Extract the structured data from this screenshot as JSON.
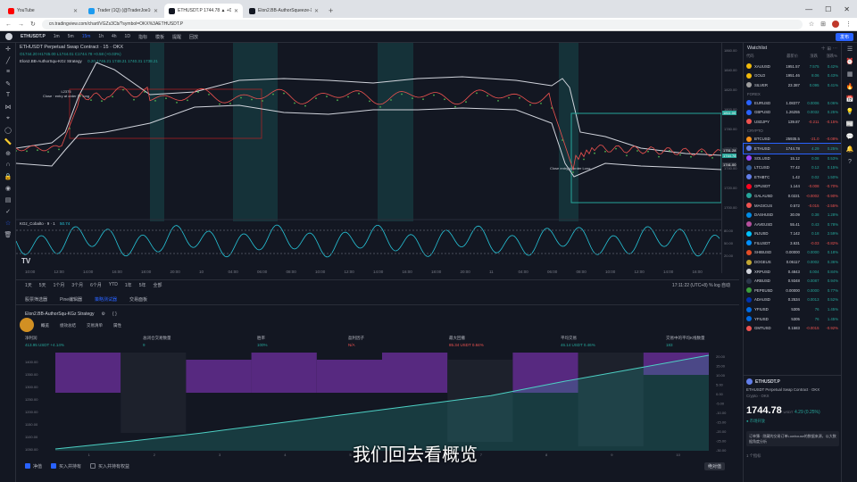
{
  "browser": {
    "tabs": [
      {
        "label": "YouTube",
        "color": "#ff0000",
        "active": false
      },
      {
        "label": "Trader (1Q) (@TraderJoe1Q) / X",
        "color": "#1d9bf0",
        "active": false
      },
      {
        "label": "ETHUSDT.P 1744.78 ▲ +0.25%",
        "color": "#131722",
        "active": true
      },
      {
        "label": "Elon2.BB-AuthorSqueeze-XG",
        "color": "#131722",
        "active": false
      }
    ],
    "url": "cn.tradingview.com/chart/VGZs3Cb/?symbol=OKX%3AETHUSDT.P"
  },
  "toolbar": {
    "symbol": "ETHUSDT.P",
    "buttons": [
      "1m",
      "5m",
      "15m",
      "1h",
      "4h",
      "1D",
      "指标",
      "模板",
      "提醒",
      "回放"
    ],
    "active_interval": "15m",
    "publish_label": "发布"
  },
  "chart": {
    "title": "ETHUSDT Perpetual Swap Contract · 15 · OKX",
    "ohlc": "O1744.20 H1745.00 L1744.01 C1744.78 +0.58 (+0.03%)",
    "indicator": "Elon2.BB-AuthorSqu-KGz Strategy",
    "indicator_vals": "0.20 1746.21 1748.21 1740.31 1738.21",
    "oscillator_label": "KGz_Cobalto · 9 · 1",
    "oscillator_val": "50.74",
    "price_labels": [
      "1860.00",
      "1840.00",
      "1820.00",
      "1800.00",
      "1780.00",
      "1760.00",
      "1740.00",
      "1720.00",
      "1700.00"
    ],
    "price_tags": [
      {
        "text": "1811.00",
        "color": "#26a69a"
      },
      {
        "text": "1751.28",
        "color": "#2a2e39"
      },
      {
        "text": "1744.78",
        "color": "#26a69a"
      },
      {
        "text": "1741.00",
        "color": "#2a2e39"
      }
    ],
    "osc_labels": [
      "80.00",
      "50.00",
      "20.00"
    ],
    "x_labels": [
      "10:00",
      "12:00",
      "14:00",
      "16:00",
      "18:00",
      "20:00",
      "10",
      "04:00",
      "06:00",
      "08:00",
      "10:00",
      "12:00",
      "14:00",
      "16:00",
      "18:00",
      "20:00",
      "11",
      "04:00",
      "06:00",
      "08:00",
      "10:00",
      "12:00",
      "14:00",
      "16:00"
    ],
    "annotations": [
      {
        "text": "L2375\nClose · entry at order 1 · long"
      },
      {
        "text": "Close entry(s) order Long"
      }
    ],
    "tv_logo": "TV"
  },
  "range_bar": {
    "items": [
      "1天",
      "5天",
      "1个月",
      "3个月",
      "6个月",
      "YTD",
      "1年",
      "5年",
      "全部"
    ],
    "right": "17:11:22 (UTC+8)  %  log  自动"
  },
  "panel_tabs": {
    "items": [
      "股票筛选器",
      "Pine编辑器",
      "策略测试器",
      "交易面板"
    ],
    "active": 2
  },
  "strategy": {
    "name": "Elon2.BB-AuthorSqu-KGz Strategy",
    "subtabs": [
      "概览",
      "绩效总结",
      "交易清单",
      "属性"
    ]
  },
  "metrics": [
    {
      "label": "净利润",
      "value": "413.95 USDT  +4.14%",
      "color": "up"
    },
    {
      "label": "总闭仓交易数量",
      "value": "9",
      "color": "up"
    },
    {
      "label": "胜率",
      "value": "100%",
      "color": "up"
    },
    {
      "label": "盈利因子",
      "value": "N/A",
      "color": "red"
    },
    {
      "label": "最大回撤",
      "value": "85.34 USDT  0.84%",
      "color": "red"
    },
    {
      "label": "平均交易",
      "value": "46.14 USDT  0.46%",
      "color": "up"
    },
    {
      "label": "交易中的平均K线数量",
      "value": "183",
      "color": "up"
    }
  ],
  "equity_chart": {
    "type": "area",
    "y_left": [
      "1400.00",
      "1350.00",
      "1300.00",
      "1250.00",
      "1200.00",
      "1150.00",
      "1100.00",
      "1050.00"
    ],
    "y_right": [
      "20.00",
      "15.00",
      "10.00",
      "5.00",
      "0.00",
      "-5.00",
      "-10.00",
      "-15.00",
      "-20.00",
      "-25.00",
      "-30.00"
    ],
    "x_ticks": [
      "1",
      "2",
      "3",
      "4",
      "5",
      "6",
      "7",
      "8",
      "9",
      "10"
    ],
    "bars": [
      {
        "kind": "purple",
        "top": 0,
        "bottom": 45
      },
      {
        "kind": "dark",
        "top": 0,
        "bottom": 90
      },
      {
        "kind": "purple",
        "top": 8,
        "bottom": 45
      },
      {
        "kind": "purple",
        "top": 0,
        "bottom": 45
      },
      {
        "kind": "purple",
        "top": 8,
        "bottom": 45
      },
      {
        "kind": "purple",
        "top": 0,
        "bottom": 45
      },
      {
        "kind": "dark",
        "top": 8,
        "bottom": 100
      },
      {
        "kind": "purple",
        "top": 0,
        "bottom": 45
      },
      {
        "kind": "dark",
        "top": 0,
        "bottom": 105
      },
      {
        "kind": "purple",
        "top": 0,
        "bottom": 25
      }
    ],
    "equity": [
      0,
      0.08,
      0.17,
      0.27,
      0.37,
      0.47,
      0.57,
      0.72,
      0.86,
      1.0
    ]
  },
  "bottom_legend": {
    "items": [
      "净值",
      "买入并持有"
    ],
    "extra": "买入并持有权益",
    "abs_label": "绝对值"
  },
  "watchlist": {
    "title": "Watchlist",
    "cols": [
      "代码",
      "最新价",
      "涨跌",
      "涨跌%"
    ],
    "sections": [
      {
        "name": "",
        "rows": [
          {
            "s": "XAUUSD",
            "p": "1951.57",
            "c": "7.575",
            "cp": "0.42%",
            "up": true,
            "color": "#f0b90b"
          },
          {
            "s": "GOLD",
            "p": "1951.46",
            "c": "8.06",
            "cp": "0.43%",
            "up": true,
            "color": "#f0b90b"
          },
          {
            "s": "SILVER",
            "p": "23.387",
            "c": "0.095",
            "cp": "0.41%",
            "up": true,
            "color": "#9e9e9e"
          }
        ]
      },
      {
        "name": "FOREX",
        "rows": [
          {
            "s": "EURUSD",
            "p": "1.08377",
            "c": "0.0006",
            "cp": "0.06%",
            "up": true,
            "color": "#2962ff"
          },
          {
            "s": "GBPUSD",
            "p": "1.26255",
            "c": "0.0032",
            "cp": "0.25%",
            "up": true,
            "color": "#2962ff"
          },
          {
            "s": "USDJPY",
            "p": "139.87",
            "c": "-0.211",
            "cp": "-0.15%",
            "up": false,
            "color": "#ef5350"
          }
        ]
      },
      {
        "name": "CRYPTO",
        "rows": [
          {
            "s": "BTCUSD",
            "p": "25935.5",
            "c": "-21.0",
            "cp": "-0.08%",
            "up": false,
            "color": "#f7931a"
          },
          {
            "s": "ETHUSD",
            "p": "1744.78",
            "c": "4.29",
            "cp": "0.25%",
            "up": true,
            "color": "#627eea",
            "sel": true
          },
          {
            "s": "SOLUSD",
            "p": "15.12",
            "c": "0.08",
            "cp": "0.53%",
            "up": true,
            "color": "#9945ff"
          },
          {
            "s": "LTCUSD",
            "p": "77.42",
            "c": "0.12",
            "cp": "0.15%",
            "up": true,
            "color": "#345d9d"
          },
          {
            "s": "ETHBTC",
            "p": "1.42",
            "c": "0.02",
            "cp": "1.50%",
            "up": true,
            "color": "#627eea"
          },
          {
            "s": "OPUSDT",
            "p": "1.144",
            "c": "-0.008",
            "cp": "-0.70%",
            "up": false,
            "color": "#ff0420"
          },
          {
            "s": "GALAUSD",
            "p": "0.0221",
            "c": "-0.0002",
            "cp": "-0.90%",
            "up": false,
            "color": "#26a69a"
          },
          {
            "s": "MAGICUS",
            "p": "0.572",
            "c": "-0.015",
            "cp": "-2.55%",
            "up": false,
            "color": "#ef5350"
          },
          {
            "s": "DASHUSD",
            "p": "30.09",
            "c": "0.38",
            "cp": "1.28%",
            "up": true,
            "color": "#008ce7"
          },
          {
            "s": "AAVEUSD",
            "p": "55.41",
            "c": "0.43",
            "cp": "0.78%",
            "up": true,
            "color": "#b6509e"
          },
          {
            "s": "INJUSD",
            "p": "7.142",
            "c": "0.18",
            "cp": "2.59%",
            "up": true,
            "color": "#00c2ff"
          },
          {
            "s": "FILUSDT",
            "p": "3.631",
            "c": "-0.03",
            "cp": "-0.82%",
            "up": false,
            "color": "#0090ff"
          },
          {
            "s": "SHIBUSD",
            "p": "0.00000",
            "c": "0.0000",
            "cp": "0.18%",
            "up": true,
            "color": "#e44d26"
          },
          {
            "s": "DOGEUS",
            "p": "0.06117",
            "c": "0.0002",
            "cp": "0.36%",
            "up": true,
            "color": "#c2a633"
          },
          {
            "s": "XRPUSD",
            "p": "0.4843",
            "c": "0.004",
            "cp": "0.84%",
            "up": true,
            "color": "#d1d4dc"
          },
          {
            "s": "ARBUSD",
            "p": "0.9348",
            "c": "0.0087",
            "cp": "0.94%",
            "up": true,
            "color": "#2d374b"
          },
          {
            "s": "PEPEUSD",
            "p": "0.00000",
            "c": "0.0000",
            "cp": "0.77%",
            "up": true,
            "color": "#3c9e3c"
          },
          {
            "s": "ADAUSD",
            "p": "0.2534",
            "c": "0.0013",
            "cp": "0.52%",
            "up": true,
            "color": "#0033ad"
          },
          {
            "s": "YFIUSD",
            "p": "5305",
            "c": "76",
            "cp": "1.45%",
            "up": true,
            "color": "#006ae3"
          },
          {
            "s": "YFIUSD",
            "p": "5305",
            "c": "76",
            "cp": "1.45%",
            "up": true,
            "color": "#006ae3"
          },
          {
            "s": "GMTUSD",
            "p": "0.1583",
            "c": "-0.0015",
            "cp": "-0.92%",
            "up": false,
            "color": "#ef5350"
          }
        ]
      }
    ]
  },
  "detail": {
    "symbol": "ETHUSDT.P",
    "desc": "ETHUSDT Perpetual Swap Contract · OKX",
    "sub": "Crypto · OKX",
    "price": "1744.78",
    "unit": "USDT",
    "change": "4.29 (0.25%)",
    "status": "● 市场开放",
    "note": "订单簿 · 隐藏的交易订单Lowhouse的数据来源，以大数据角度分析",
    "news": "1 个指标"
  },
  "subtitle": "我们回去看概览"
}
